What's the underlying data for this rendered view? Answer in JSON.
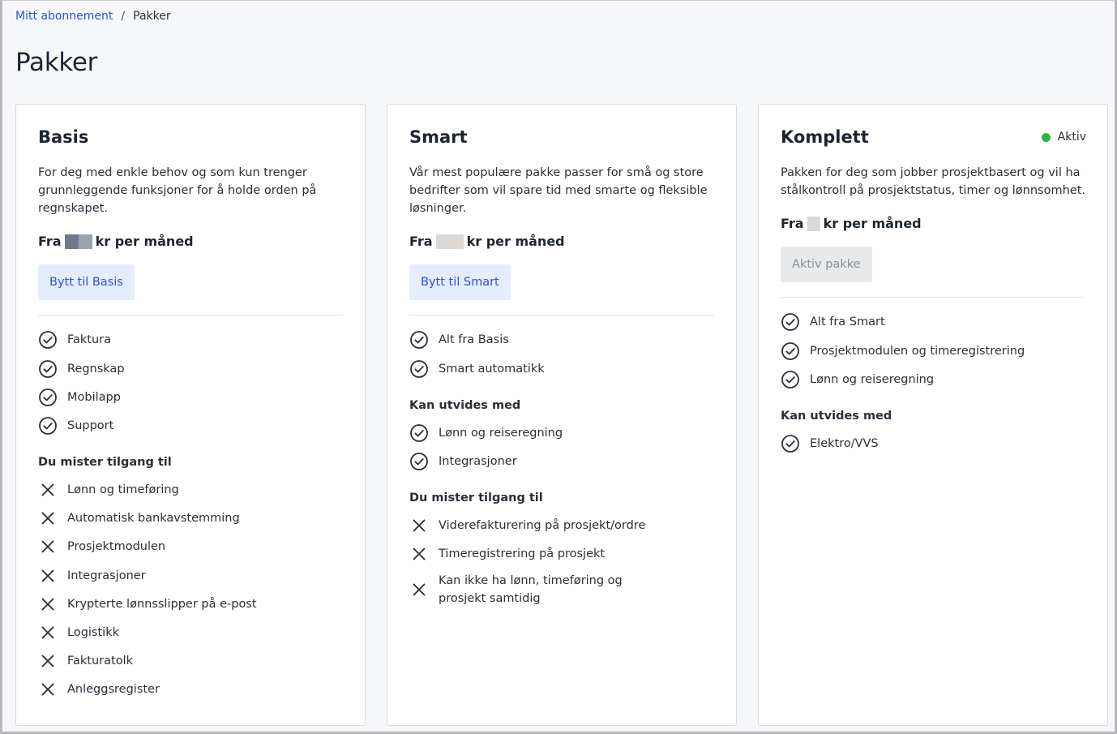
{
  "breadcrumb": {
    "parent": "Mitt abonnement",
    "separator": "/",
    "current": "Pakker"
  },
  "page_title": "Pakker",
  "plans": [
    {
      "name": "Basis",
      "description": "For deg med enkle behov og som kun trenger grunnleggende funksjoner for å holde orden på regnskapet.",
      "price_prefix": "Fra",
      "price_suffix": "kr per måned",
      "button_label": "Bytt til Basis",
      "features": [
        "Faktura",
        "Regnskap",
        "Mobilapp",
        "Support"
      ],
      "lost_label": "Du mister tilgang til",
      "lost": [
        "Lønn og timeføring",
        "Automatisk bankavstemming",
        "Prosjektmodulen",
        "Integrasjoner",
        "Krypterte lønnsslipper på e-post",
        "Logistikk",
        "Fakturatolk",
        "Anleggsregister"
      ]
    },
    {
      "name": "Smart",
      "description": "Vår mest populære pakke passer for små og store bedrifter som vil spare tid med smarte og fleksible løsninger.",
      "price_prefix": "Fra",
      "price_suffix": "kr per måned",
      "button_label": "Bytt til Smart",
      "features": [
        "Alt fra Basis",
        "Smart automatikk"
      ],
      "extend_label": "Kan utvides med",
      "extend": [
        "Lønn og reiseregning",
        "Integrasjoner"
      ],
      "lost_label": "Du mister tilgang til",
      "lost": [
        "Viderefakturering på prosjekt/ordre",
        "Timeregistrering på prosjekt",
        "Kan ikke ha lønn, timeføring og prosjekt samtidig"
      ]
    },
    {
      "name": "Komplett",
      "status": "Aktiv",
      "description": "Pakken for deg som jobber prosjektbasert og vil ha stålkontroll på prosjektstatus, timer og lønnsomhet.",
      "price_prefix": "Fra",
      "price_suffix": "kr per måned",
      "button_label": "Aktiv pakke",
      "features": [
        "Alt fra Smart",
        "Prosjektmodulen og timeregistrering",
        "Lønn og reiseregning"
      ],
      "extend_label": "Kan utvides med",
      "extend": [
        "Elektro/VVS"
      ]
    }
  ],
  "colors": {
    "link": "#2b52d6",
    "active_dot": "#2fb344",
    "button_bg": "#e5ecfd"
  }
}
